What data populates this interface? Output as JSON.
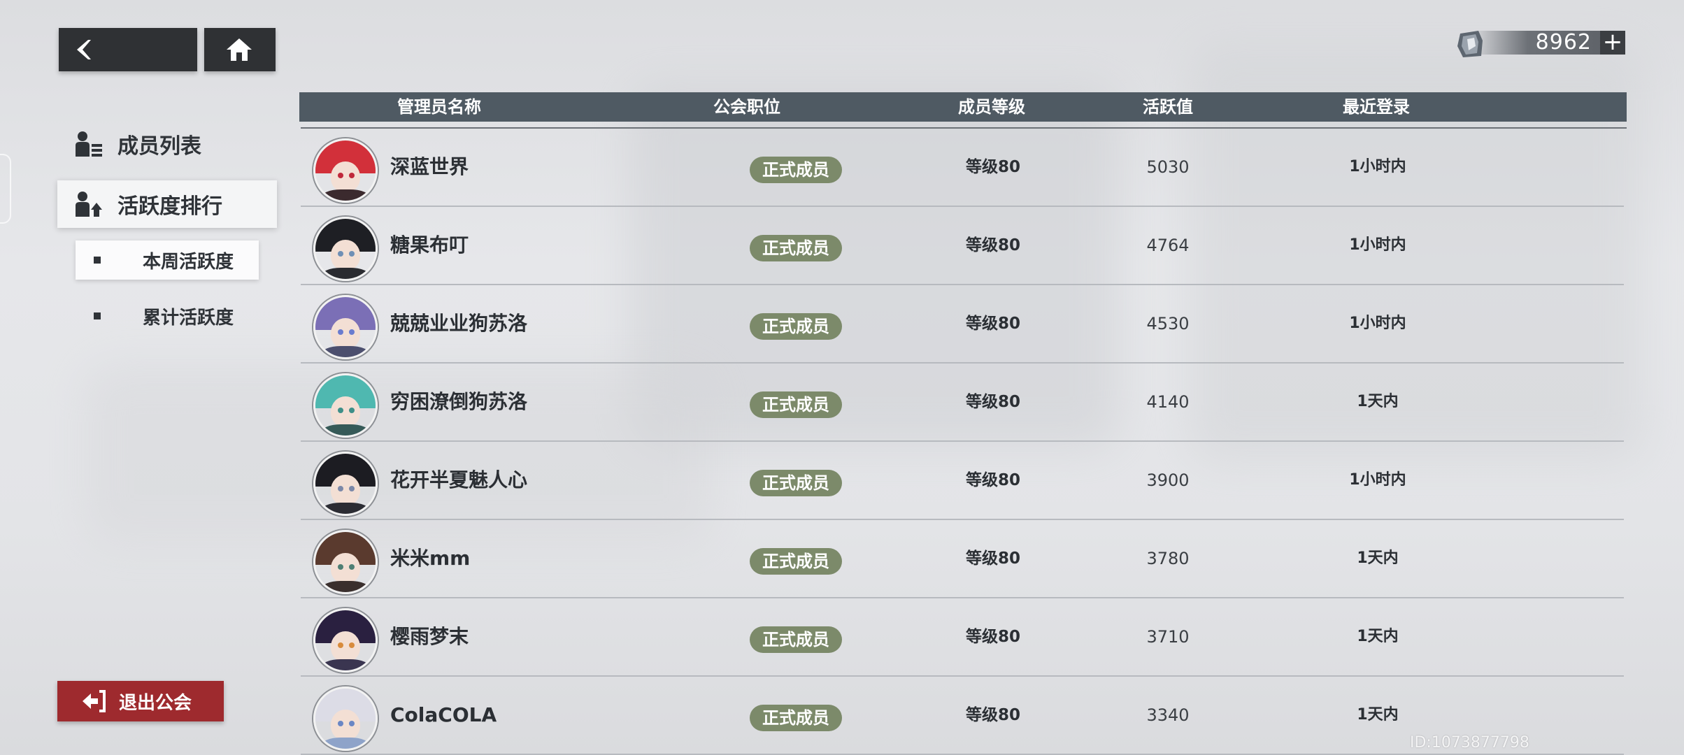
{
  "currency": {
    "amount": "8962",
    "plus_label": "+"
  },
  "sidebar": {
    "members_label": "成员列表",
    "activity_label": "活跃度排行",
    "sub": {
      "week_label": "本周活跃度",
      "total_label": "累计活跃度"
    },
    "exit_label": "退出公会"
  },
  "table": {
    "headers": {
      "name": "管理员名称",
      "position": "公会职位",
      "level": "成员等级",
      "activity": "活跃值",
      "login": "最近登录"
    },
    "rows": [
      {
        "name": "深蓝世界",
        "position": "正式成员",
        "level": "等级80",
        "activity": "5030",
        "login": "1小时内",
        "hair_color": "#d2303a",
        "eye_color": "#c0283a",
        "body_color": "#3b2a2e"
      },
      {
        "name": "糖果布叮",
        "position": "正式成员",
        "level": "等级80",
        "activity": "4764",
        "login": "1小时内",
        "hair_color": "#1e1f24",
        "eye_color": "#6f8fb5",
        "body_color": "#2a2b30"
      },
      {
        "name": "兢兢业业狗苏洛",
        "position": "正式成员",
        "level": "等级80",
        "activity": "4530",
        "login": "1小时内",
        "hair_color": "#7b6fb6",
        "eye_color": "#6a7ccf",
        "body_color": "#4c4f6e"
      },
      {
        "name": "穷困潦倒狗苏洛",
        "position": "正式成员",
        "level": "等级80",
        "activity": "4140",
        "login": "1天内",
        "hair_color": "#4fb8b0",
        "eye_color": "#3e8f88",
        "body_color": "#365a58"
      },
      {
        "name": "花开半夏魅人心",
        "position": "正式成员",
        "level": "等级80",
        "activity": "3900",
        "login": "1小时内",
        "hair_color": "#1c1c22",
        "eye_color": "#7b88a8",
        "body_color": "#2b2c33"
      },
      {
        "name": "米米mm",
        "position": "正式成员",
        "level": "等级80",
        "activity": "3780",
        "login": "1天内",
        "hair_color": "#5a3a2e",
        "eye_color": "#4f7f74",
        "body_color": "#3a2f2d"
      },
      {
        "name": "樱雨梦末",
        "position": "正式成员",
        "level": "等级80",
        "activity": "3710",
        "login": "1天内",
        "hair_color": "#2a2040",
        "eye_color": "#d88b3c",
        "body_color": "#3a3550"
      },
      {
        "name": "ColaCOLA",
        "position": "正式成员",
        "level": "等级80",
        "activity": "3340",
        "login": "1天内",
        "hair_color": "#dcdce6",
        "eye_color": "#6a86c4",
        "body_color": "#8ea3c9"
      }
    ]
  },
  "footer": {
    "uid": "ID:1073877798"
  },
  "colors": {
    "accent_exit": "#9e2a2e",
    "pill": "#7c8a6a",
    "header": "#4f5a63"
  }
}
